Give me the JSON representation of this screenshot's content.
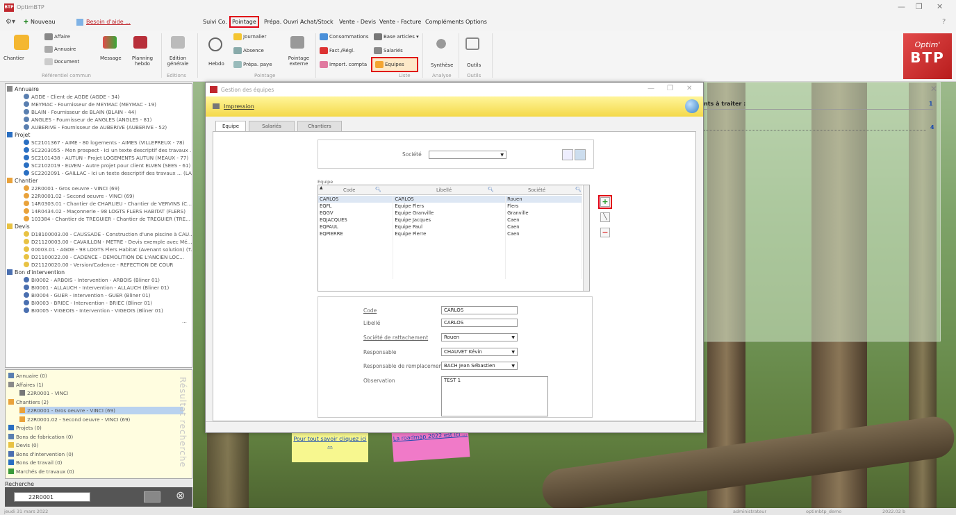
{
  "app": {
    "icon_text": "BTP",
    "title": "OptimBTP",
    "win_min": "—",
    "win_max": "❐",
    "win_close": "✕",
    "help": "?"
  },
  "menu": {
    "quick": "Nouveau",
    "help_link": "Besoin d'aide ...",
    "items": [
      "Suivi Co.",
      "Pointage",
      "Prépa. Ouvri",
      "Achat/Stock",
      "Vente - Devis",
      "Vente - Facture",
      "Compléments",
      "Options"
    ],
    "highlighted": "Pointage"
  },
  "ribbon": {
    "chantier": "Chantier",
    "affaire": "Affaire",
    "annuaire": "Annuaire",
    "document": "Document",
    "message": "Message",
    "planning": "Planning hebdo",
    "edition": "Edition générale",
    "hebdo": "Hebdo",
    "journalier": "Journalier",
    "absence": "Absence",
    "prepa_paye": "Prépa. paye",
    "pointage_externe": "Pointage externe",
    "consommations": "Consommations",
    "fact_regl": "Fact./Régl.",
    "import_compta": "Import. compta",
    "base_articles": "Base articles",
    "salaries": "Salariés",
    "equipes": "Equipes",
    "synthese": "Synthèse",
    "outils": "Outils",
    "groups": {
      "ref": "Référentiel commun",
      "editions": "Editions",
      "pointage": "Pointage",
      "liste": "Liste",
      "analyse": "Analyse",
      "outils": "Outils"
    },
    "logo_top": "Optim'",
    "logo_bottom": "BTP"
  },
  "tree": {
    "annuaire": "Annuaire",
    "annuaire_items": [
      "AGDE - Client de AGDE (AGDE - 34)",
      "MEYMAC - Fournisseur de MEYMAC (MEYMAC - 19)",
      "BLAIN - Fournisseur de BLAIN (BLAIN - 44)",
      "ANGLES - Fournisseur de ANGLES (ANGLES - 81)",
      "AUBERIVE - Fournisseur de AUBERIVE (AUBERIVE - 52)"
    ],
    "projet": "Projet",
    "projet_items": [
      "SC2101367 - AIME - 80 logements - AIMES (VILLEPREUX - 78)",
      "SC2203055 - Mon prospect - Ici un texte descriptif des travaux ...",
      "SC2101438 - AUTUN - Projet LOGEMENTS AUTUN (MEAUX - 77)",
      "SC2102019 - ELVEN - Autre projet pour client ELVEN (SEES - 61)",
      "SC2202091 - GAILLAC - Ici un texte descriptif des travaux ... (LA..."
    ],
    "chantier": "Chantier",
    "chantier_items": [
      "22R0001 - Gros oeuvre - VINCI (69)",
      "22R0001.02 - Second oeuvre - VINCI (69)",
      "14R0303.01 - Chantier de CHARLIEU - Chantier de VERVINS (C...",
      "14R0434.02 - Maçonnerie - 98 LOGTS FLERS HABITAT (FLERS)",
      "103384 - Chantier de TREGUIER - Chantier de TREGUIER (TRE..."
    ],
    "devis": "Devis",
    "devis_items": [
      "D18100003.00 - CAUSSADE - Construction d'une piscine à CAU...",
      "D21120003.00 - CAVAILLON - METRE - Devis exemple avec Mé...",
      "00003.01 - AGDE - 98 LOGTS Flers Habitat (Avenant solution) (T...",
      "D21100022.00 - CADENCE - DEMOLITION DE L'ANCIEN LOC...",
      "D21120020.00 - Version/Cadence - REFECTION DE COUR"
    ],
    "bon": "Bon d'intervention",
    "bon_items": [
      "BI0002 - ARBOIS - Intervention - ARBOIS (Bliner 01)",
      "BI0001 - ALLAUCH - Intervention - ALLAUCH (Bliner 01)",
      "BI0004 - GUER - Intervention - GUER (Bliner 01)",
      "BI0003 - BRIEC - Intervention - BRIEC (Bliner 01)",
      "BI0005 - VIGEOIS - Intervention - VIGEOIS (Bliner 01)"
    ],
    "more": "..."
  },
  "results": {
    "vertical": "Résultat recherche",
    "items": [
      "Annuaire (0)",
      "Affaires (1)",
      "22R0001 - VINCI",
      "Chantiers (2)",
      "22R0001 - Gros oeuvre - VINCI (69)",
      "22R0001.02 - Second oeuvre - VINCI (69)",
      "Projets (0)",
      "Bons de fabrication (0)",
      "Devis (0)",
      "Bons d'intervention (0)",
      "Bons de travail (0)",
      "Marchés de travaux (0)"
    ]
  },
  "search": {
    "label": "Recherche",
    "value": "22R0001",
    "clear": "⊗"
  },
  "todo": {
    "title": "nts à traiter :",
    "count1": "1",
    "count2": "4"
  },
  "status": {
    "date": "jeudi 31 mars 2022",
    "user": "administrateur",
    "db": "optimbtp_demo",
    "version": "2022.02 b"
  },
  "dialog": {
    "title": "Gestion des équipes",
    "impression": "Impression",
    "tabs": [
      "Equipe",
      "Salariés",
      "Chantiers"
    ],
    "societe_label": "Société",
    "societe_value": "",
    "grid_title": "Equipe",
    "columns": [
      "Code",
      "Libellé",
      "Société"
    ],
    "rows": [
      [
        "CARLOS",
        "CARLOS",
        "Rouen"
      ],
      [
        "EQFL",
        "Equipe Flers",
        "Flers"
      ],
      [
        "EQGV",
        "Equipe Granville",
        "Granville"
      ],
      [
        "EQJACQUES",
        "Equipe Jacques",
        "Caen"
      ],
      [
        "EQPAUL",
        "Equipe Paul",
        "Caen"
      ],
      [
        "EQPIERRE",
        "Equipe Pierre",
        "Caen"
      ]
    ],
    "form": {
      "code_label": "Code",
      "code": "CARLOS",
      "libelle_label": "Libellé",
      "libelle": "CARLOS",
      "societe_label": "Société de rattachement",
      "societe": "Rouen",
      "resp_label": "Responsable",
      "resp": "CHAUVET Kévin",
      "remp_label": "Responsable de remplacement",
      "remp": "BACH Jean Sébastien",
      "obs_label": "Observation",
      "obs": "TEST 1"
    }
  },
  "stickies": {
    "yellow": "Pour tout savoir cliquez ici ...",
    "pink": "La roadmap 2022 est ici ..."
  },
  "colors": {
    "accent_red": "#e00014",
    "selection": "#dde7f4",
    "banner": "#f4d94a"
  }
}
